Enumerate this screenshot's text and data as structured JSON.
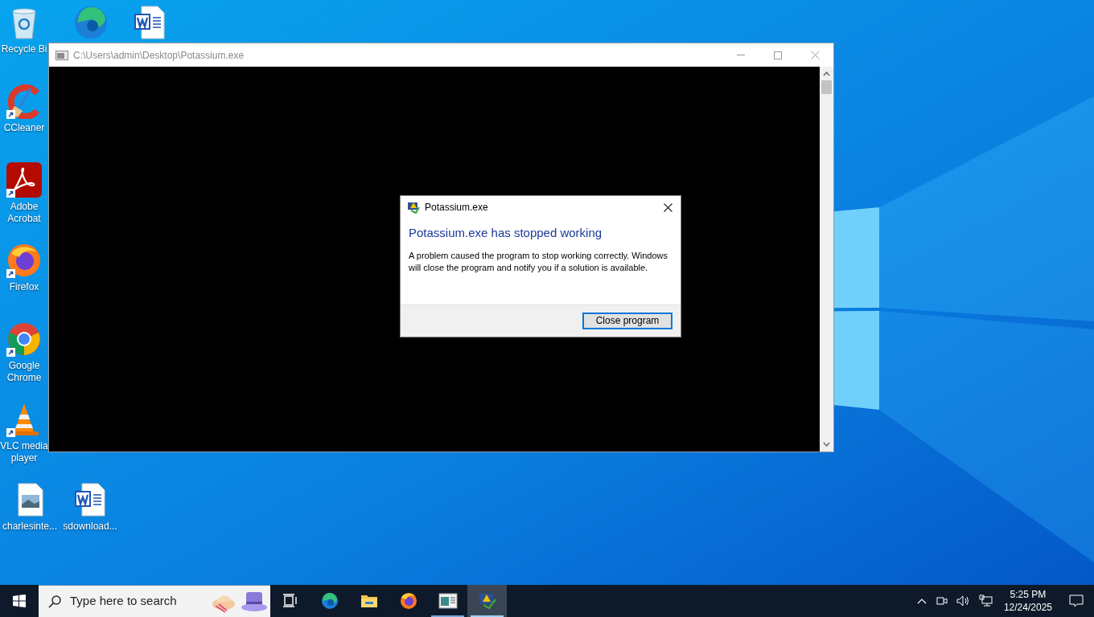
{
  "desktop_icons": [
    {
      "kind": "recycle-bin",
      "label": "Recycle Bi"
    },
    {
      "kind": "edge"
    },
    {
      "kind": "word"
    },
    {
      "kind": "ccleaner",
      "label": "CCleaner"
    },
    {
      "kind": "acrobat",
      "label": "Adobe Acrobat"
    },
    {
      "kind": "firefox",
      "label": "Firefox"
    },
    {
      "kind": "chrome",
      "label": "Google Chrome"
    },
    {
      "kind": "vlc",
      "label": "VLC media player"
    },
    {
      "kind": "image-file",
      "label": "charlesinte..."
    },
    {
      "kind": "word",
      "label": "sdownload..."
    }
  ],
  "console_window": {
    "title": "C:\\Users\\admin\\Desktop\\Potassium.exe"
  },
  "error_dialog": {
    "title": "Potassium.exe",
    "heading": "Potassium.exe has stopped working",
    "message": "A problem caused the program to stop working correctly. Windows will close the program and notify you if a solution is available.",
    "button": "Close program"
  },
  "taskbar": {
    "search": {
      "placeholder": "Type here to search"
    },
    "apps": [
      {
        "kind": "task-view",
        "running": false,
        "selected": false
      },
      {
        "kind": "edge",
        "running": false,
        "selected": false
      },
      {
        "kind": "explorer",
        "running": false,
        "selected": false
      },
      {
        "kind": "firefox",
        "running": false,
        "selected": false
      },
      {
        "kind": "app-window",
        "running": true,
        "selected": false
      },
      {
        "kind": "error-app",
        "running": true,
        "selected": true
      }
    ],
    "time": "5:25 PM",
    "date": "12/24/2025"
  }
}
